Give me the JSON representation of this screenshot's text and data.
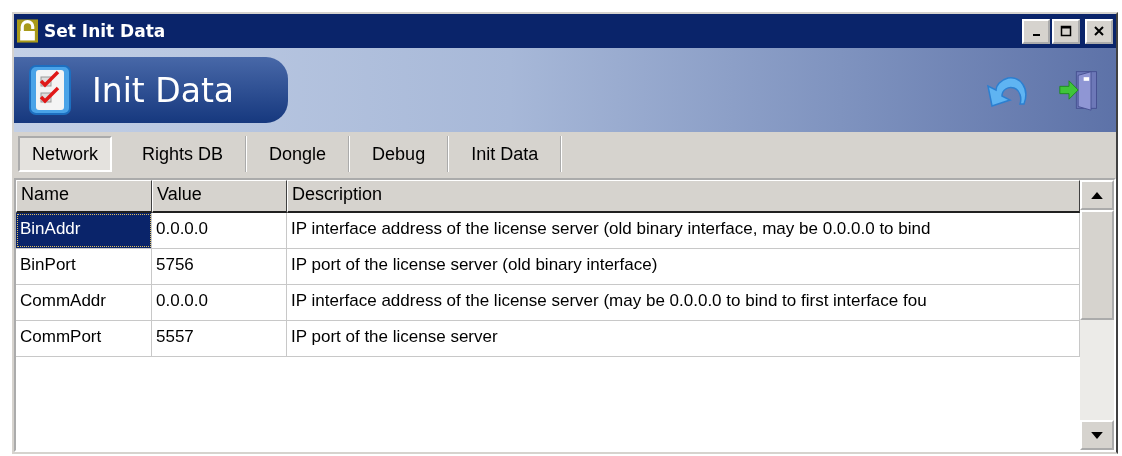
{
  "window": {
    "title": "Set Init Data"
  },
  "banner": {
    "title": "Init Data"
  },
  "tabs": [
    {
      "label": "Network",
      "selected": true
    },
    {
      "label": "Rights DB",
      "selected": false
    },
    {
      "label": "Dongle",
      "selected": false
    },
    {
      "label": "Debug",
      "selected": false
    },
    {
      "label": "Init Data",
      "selected": false
    }
  ],
  "table": {
    "columns": [
      "Name",
      "Value",
      "Description"
    ],
    "rows": [
      {
        "name": "BinAddr",
        "value": "0.0.0.0",
        "description": "IP interface address of the license server (old binary interface, may be 0.0.0.0 to bind",
        "selected": true
      },
      {
        "name": "BinPort",
        "value": "5756",
        "description": "IP port of the license server (old binary interface)",
        "selected": false
      },
      {
        "name": "CommAddr",
        "value": "0.0.0.0",
        "description": "IP interface address of the license server (may be 0.0.0.0 to bind to first interface fou",
        "selected": false
      },
      {
        "name": "CommPort",
        "value": "5557",
        "description": "IP port of the license server",
        "selected": false
      }
    ]
  }
}
